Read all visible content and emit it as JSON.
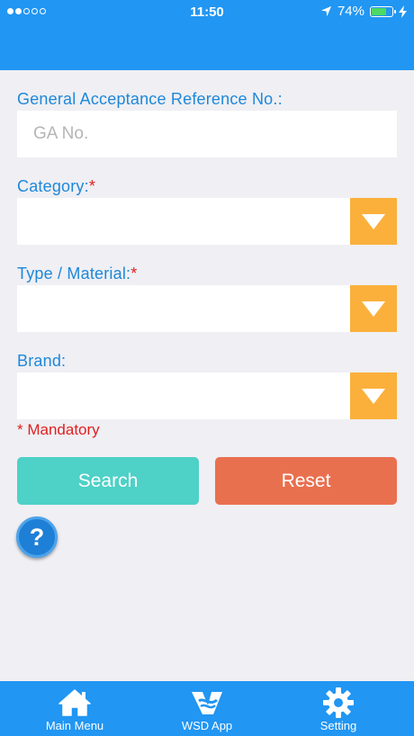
{
  "status_bar": {
    "time": "11:50",
    "battery": "74%",
    "battery_level": 0.74
  },
  "form": {
    "ga": {
      "label": "General Acceptance Reference No.:",
      "placeholder": "GA No.",
      "value": ""
    },
    "category": {
      "label": "Category:",
      "required_mark": "*",
      "value": ""
    },
    "type_material": {
      "label": "Type / Material:",
      "required_mark": "*",
      "value": ""
    },
    "brand": {
      "label": "Brand:",
      "value": ""
    },
    "mandatory_note": "* Mandatory"
  },
  "buttons": {
    "search": "Search",
    "reset": "Reset",
    "help": "?"
  },
  "tabbar": {
    "items": [
      {
        "label": "Main Menu",
        "icon": "home-icon"
      },
      {
        "label": "WSD App",
        "icon": "wsd-logo-icon"
      },
      {
        "label": "Setting",
        "icon": "gear-icon"
      }
    ]
  },
  "colors": {
    "header": "#2196f3",
    "label": "#1e88d9",
    "dropdown_button": "#fbb03b",
    "search_button": "#4ed1c7",
    "reset_button": "#e9704f",
    "required": "#e02020"
  }
}
